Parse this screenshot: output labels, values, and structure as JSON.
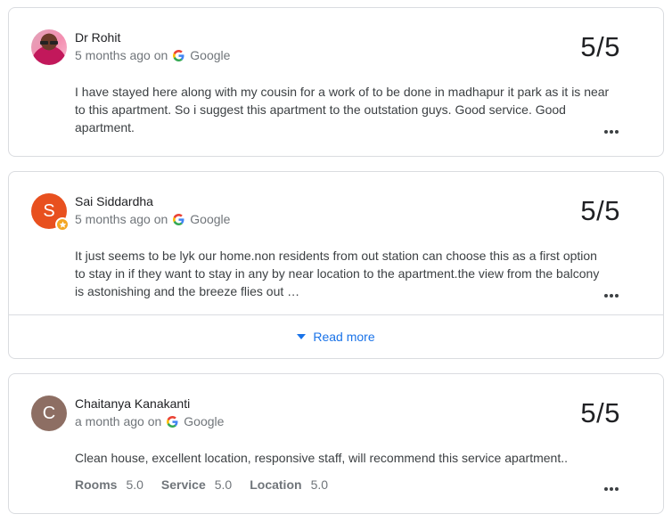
{
  "reviews": [
    {
      "avatar_letter": "",
      "name": "Dr Rohit",
      "time": "5 months ago on",
      "source": "Google",
      "score": "5/5",
      "text": "I have stayed here along with my cousin for a work of to be done in madhapur it park as it is near to this apartment. So i suggest this apartment to the outstation guys. Good service. Good apartment."
    },
    {
      "avatar_letter": "S",
      "name": "Sai Siddardha",
      "time": "5 months ago on",
      "source": "Google",
      "score": "5/5",
      "text": "It just seems to be lyk our home.non residents from out station can choose this as a first option to stay in if they want to stay in any by near location to the apartment.the view from the balcony is astonishing and the breeze flies out …",
      "read_more": "Read more"
    },
    {
      "avatar_letter": "C",
      "name": "Chaitanya Kanakanti",
      "time": "a month ago on",
      "source": "Google",
      "score": "5/5",
      "text": "Clean house, excellent location, responsive staff, will recommend this service apartment..",
      "ratings": [
        {
          "label": "Rooms",
          "value": "5.0"
        },
        {
          "label": "Service",
          "value": "5.0"
        },
        {
          "label": "Location",
          "value": "5.0"
        }
      ]
    }
  ],
  "colors": {
    "link": "#1a73e8",
    "avatar_orange": "#e8501f",
    "avatar_brown": "#8d6e63",
    "badge": "#f4a623"
  },
  "icons": {
    "source_logo": "google-g-icon",
    "overflow": "more-horiz-icon",
    "expand": "caret-down-icon",
    "local_guide_badge": "star-badge-icon"
  }
}
